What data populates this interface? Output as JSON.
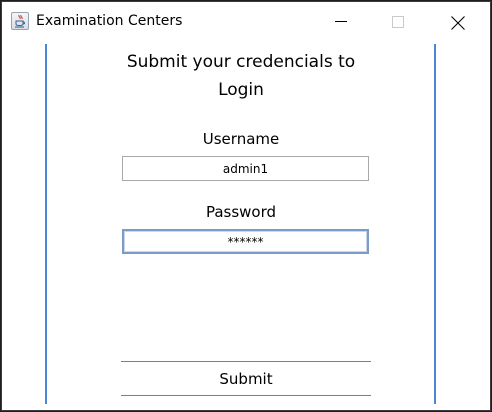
{
  "window": {
    "title": "Examination Centers",
    "app_icon": "java-cup-icon",
    "controls": {
      "minimize_icon": "minimize-icon",
      "maximize_icon": "maximize-icon",
      "close_icon": "close-icon"
    }
  },
  "login": {
    "heading_line1": "Submit your credencials to",
    "heading_line2": "Login",
    "username_label": "Username",
    "username_value": "admin1",
    "password_label": "Password",
    "password_value": "******",
    "submit_label": "Submit"
  },
  "colors": {
    "accent": "#4a87d6",
    "focus_border": "#7a9cc6",
    "background": "#ffffff"
  }
}
